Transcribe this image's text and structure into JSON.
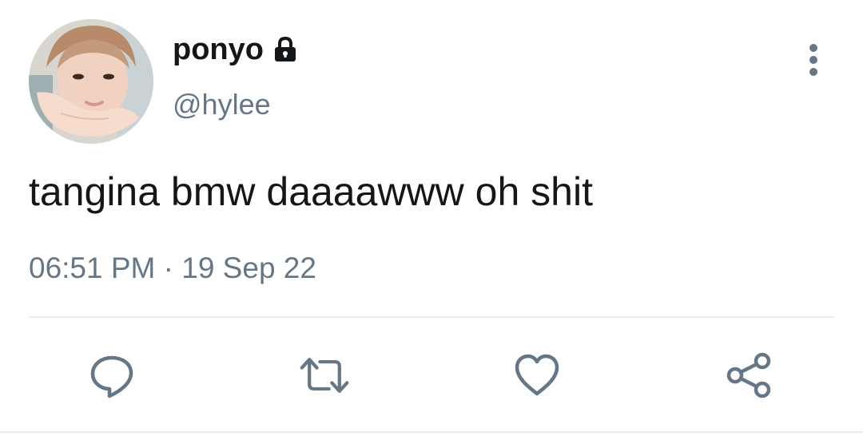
{
  "user": {
    "display_name": "ponyo",
    "handle": "@hylee",
    "protected_icon": "lock-icon",
    "avatar": "profile-photo"
  },
  "tweet": {
    "text": "tangina bmw daaaawww oh shit",
    "timestamp": "06:51 PM · 19 Sep 22"
  },
  "actions": {
    "reply_icon": "speech-bubble-icon",
    "retweet_icon": "retweet-arrows-icon",
    "like_icon": "heart-outline-icon",
    "share_icon": "share-nodes-icon",
    "more_icon": "vertical-dots-icon"
  },
  "colors": {
    "text_primary": "#14171a",
    "text_secondary": "#657786",
    "icon_color": "#657786",
    "divider": "#e6ecf0",
    "background": "#ffffff"
  }
}
